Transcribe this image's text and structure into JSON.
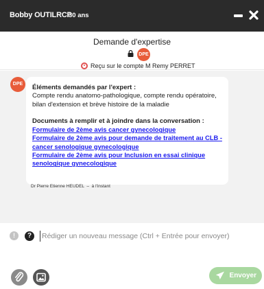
{
  "titlebar": {
    "patient_name": "Bobby OUTILRCP",
    "age": "30 ans",
    "minimize_icon": "minimize-icon",
    "close_icon": "close-icon"
  },
  "header": {
    "title": "Demande d'expertise",
    "avatar_initials": "DPE",
    "received_text": "Reçu sur le compte M Remy PERRET",
    "lock_icon": "lock-icon",
    "account_icon": "account-icon"
  },
  "message": {
    "avatar_initials": "DPE",
    "elements_title": "Éléments demandés par l'expert :",
    "elements_text": "Compte rendu anatomo-pathologique, compte rendu opératoire, bilan d'extension et brève histoire de la maladie",
    "documents_title": "Documents à remplir et à joindre dans la conversation :",
    "links": [
      "Formulaire de 2ème avis cancer gynecologique",
      "Formulaire de 2ème avis pour demande de traitement au CLB - cancer senologique gynecologique",
      "Formulaire de 2ème avis pour Inclusion en essai clinique senologique gynecologique"
    ],
    "sender": "Dr Pierre Etienne HEUDEL",
    "time": "à l'instant"
  },
  "composer": {
    "placeholder": "Rédiger un nouveau message (Ctrl + Entrée pour envoyer)",
    "info_icon": "!",
    "help_icon": "?",
    "send_label": "Envoyer"
  },
  "colors": {
    "titlebar": "#2b2b2b",
    "avatar": "#e85c3a",
    "link": "#1a1aee",
    "send": "#a9d8a0",
    "chat_bg": "#f2f2f2"
  }
}
